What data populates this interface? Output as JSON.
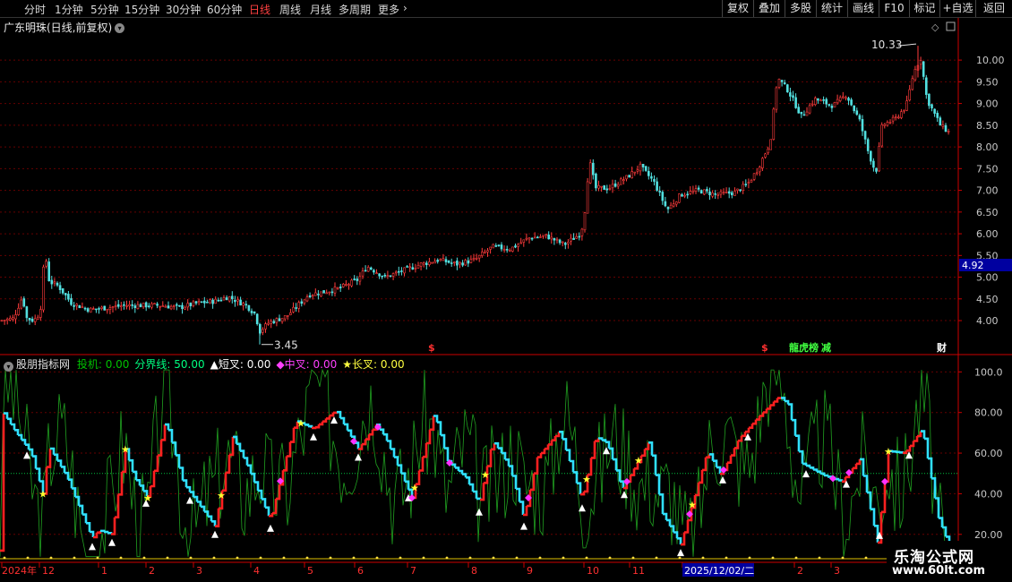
{
  "toolbar": {
    "periods": [
      "分时",
      "1分钟",
      "5分钟",
      "15分钟",
      "30分钟",
      "60分钟",
      "日线",
      "周线",
      "月线",
      "多周期",
      "更多"
    ],
    "active_period": "日线",
    "more_arrow": "chevron-right-icon",
    "buttons": [
      "复权",
      "叠加",
      "多股",
      "统计",
      "画线",
      "F10",
      "标记",
      "+自选",
      "返回"
    ]
  },
  "main_panel": {
    "title": "广东明珠(日线,前复权)",
    "title_icon": "chevron-down-icon",
    "right_icons": [
      "diamond-icon",
      "window-icon"
    ],
    "high_label": "10.33",
    "low_label": "3.45",
    "current_price": "4.92",
    "markers": [
      {
        "text": "$",
        "color": "#ff3030"
      },
      {
        "text": "$",
        "color": "#ff3030"
      },
      {
        "text": "龍虎榜",
        "color": "#40ff40"
      },
      {
        "text": "减",
        "color": "#40ff40"
      },
      {
        "text": "财",
        "color": "#ffffff"
      }
    ]
  },
  "indicator_panel": {
    "icon": "chevron-down-icon",
    "name": "股朋指标网",
    "items": [
      {
        "label": "投机: 0.00",
        "color": "#00c000"
      },
      {
        "label": "分界线: 50.00",
        "color": "#00ff80"
      },
      {
        "label": "▲短叉: 0.00",
        "color": "#ffffff"
      },
      {
        "label": "◆中叉: 0.00",
        "color": "#ff40ff"
      },
      {
        "label": "★长叉: 0.00",
        "color": "#ffff40"
      }
    ]
  },
  "date_axis": {
    "labels": [
      "2024年",
      "12",
      "1",
      "2",
      "3",
      "4",
      "5",
      "6",
      "7",
      "8",
      "9",
      "10",
      "11",
      "2025/12/02/二",
      "2",
      "3"
    ]
  },
  "watermark": {
    "line1": "乐淘公式网",
    "line2": "www.60lt.com"
  },
  "chart_data": [
    {
      "type": "candlestick",
      "name": "price",
      "x_axis": "trading days (Dec 2024 – Apr 2026)",
      "ylim": [
        3.3,
        10.6
      ],
      "yticks": [
        "10.00",
        "9.50",
        "9.00",
        "8.50",
        "8.00",
        "7.50",
        "7.00",
        "6.50",
        "6.00",
        "5.50",
        "5.00",
        "4.50",
        "4.00"
      ],
      "grid": true,
      "close_anchors": [
        [
          0,
          4.0
        ],
        [
          15,
          4.05
        ],
        [
          25,
          4.55
        ],
        [
          30,
          4.05
        ],
        [
          38,
          4.0
        ],
        [
          45,
          4.2
        ],
        [
          50,
          5.6
        ],
        [
          55,
          4.9
        ],
        [
          65,
          4.8
        ],
        [
          80,
          4.4
        ],
        [
          100,
          4.25
        ],
        [
          120,
          4.3
        ],
        [
          140,
          4.35
        ],
        [
          160,
          4.35
        ],
        [
          180,
          4.35
        ],
        [
          200,
          4.3
        ],
        [
          220,
          4.4
        ],
        [
          240,
          4.45
        ],
        [
          255,
          4.55
        ],
        [
          275,
          4.35
        ],
        [
          285,
          4.15
        ],
        [
          290,
          3.75
        ],
        [
          300,
          3.95
        ],
        [
          320,
          4.1
        ],
        [
          330,
          4.3
        ],
        [
          345,
          4.6
        ],
        [
          360,
          4.65
        ],
        [
          380,
          4.75
        ],
        [
          400,
          4.95
        ],
        [
          410,
          5.25
        ],
        [
          430,
          5.0
        ],
        [
          450,
          5.15
        ],
        [
          470,
          5.3
        ],
        [
          490,
          5.4
        ],
        [
          510,
          5.3
        ],
        [
          530,
          5.4
        ],
        [
          550,
          5.7
        ],
        [
          570,
          5.65
        ],
        [
          590,
          5.9
        ],
        [
          610,
          5.95
        ],
        [
          630,
          5.75
        ],
        [
          648,
          6.0
        ],
        [
          652,
          6.3
        ],
        [
          658,
          7.7
        ],
        [
          665,
          7.05
        ],
        [
          680,
          7.05
        ],
        [
          700,
          7.3
        ],
        [
          715,
          7.55
        ],
        [
          730,
          7.2
        ],
        [
          745,
          6.55
        ],
        [
          760,
          6.9
        ],
        [
          780,
          7.0
        ],
        [
          800,
          6.9
        ],
        [
          820,
          6.95
        ],
        [
          835,
          7.15
        ],
        [
          845,
          7.45
        ],
        [
          860,
          8.1
        ],
        [
          868,
          9.6
        ],
        [
          880,
          9.3
        ],
        [
          895,
          8.7
        ],
        [
          910,
          9.1
        ],
        [
          930,
          8.95
        ],
        [
          945,
          9.2
        ],
        [
          960,
          8.6
        ],
        [
          970,
          7.85
        ],
        [
          978,
          7.4
        ],
        [
          985,
          8.5
        ],
        [
          1000,
          8.65
        ],
        [
          1012,
          8.95
        ],
        [
          1020,
          9.7
        ],
        [
          1028,
          10.05
        ],
        [
          1035,
          9.1
        ],
        [
          1050,
          8.5
        ],
        [
          1062,
          8.3
        ]
      ]
    },
    {
      "type": "line",
      "name": "indicator",
      "ylim": [
        8,
        105
      ],
      "yticks": [
        "100.0",
        "80.00",
        "60.00",
        "40.00",
        "20.00"
      ],
      "reference_line": 50,
      "turning_points": [
        [
          2,
          81
        ],
        [
          18,
          70
        ],
        [
          35,
          60
        ],
        [
          48,
          40
        ],
        [
          55,
          63
        ],
        [
          75,
          48
        ],
        [
          103,
          18
        ],
        [
          110,
          22
        ],
        [
          125,
          20
        ],
        [
          140,
          62
        ],
        [
          150,
          48
        ],
        [
          165,
          38
        ],
        [
          185,
          76
        ],
        [
          205,
          45
        ],
        [
          240,
          24
        ],
        [
          260,
          68
        ],
        [
          275,
          55
        ],
        [
          302,
          27
        ],
        [
          330,
          76
        ],
        [
          350,
          72
        ],
        [
          375,
          81
        ],
        [
          400,
          62
        ],
        [
          420,
          74
        ],
        [
          430,
          68
        ],
        [
          460,
          38
        ],
        [
          485,
          80
        ],
        [
          500,
          56
        ],
        [
          520,
          48
        ],
        [
          535,
          35
        ],
        [
          550,
          66
        ],
        [
          560,
          60
        ],
        [
          570,
          52
        ],
        [
          585,
          28
        ],
        [
          600,
          58
        ],
        [
          625,
          71
        ],
        [
          650,
          37
        ],
        [
          665,
          68
        ],
        [
          678,
          65
        ],
        [
          695,
          42
        ],
        [
          725,
          66
        ],
        [
          740,
          30
        ],
        [
          760,
          15
        ],
        [
          770,
          30
        ],
        [
          790,
          61
        ],
        [
          805,
          49
        ],
        [
          825,
          67
        ],
        [
          845,
          77
        ],
        [
          870,
          88
        ],
        [
          880,
          84
        ],
        [
          895,
          55
        ],
        [
          920,
          49
        ],
        [
          940,
          46
        ],
        [
          960,
          57
        ],
        [
          980,
          16
        ],
        [
          992,
          61
        ],
        [
          1010,
          60
        ],
        [
          1030,
          72
        ],
        [
          1048,
          28
        ],
        [
          1062,
          12
        ]
      ],
      "up_color": "#ff2020",
      "down_color": "#30e0ff",
      "signals": {
        "short_cross": [
          30,
          103,
          125,
          163,
          212,
          240,
          302,
          350,
          373,
          400,
          456,
          535,
          585,
          650,
          677,
          697,
          760,
          807,
          835,
          900,
          945,
          982,
          1015
        ],
        "mid_cross": [
          313,
          395,
          422,
          460,
          502,
          590,
          700,
          770,
          808,
          930,
          948,
          988
        ],
        "long_cross": [
          48,
          140,
          165,
          247,
          336,
          463,
          542,
          655,
          713,
          773,
          992
        ]
      }
    }
  ]
}
